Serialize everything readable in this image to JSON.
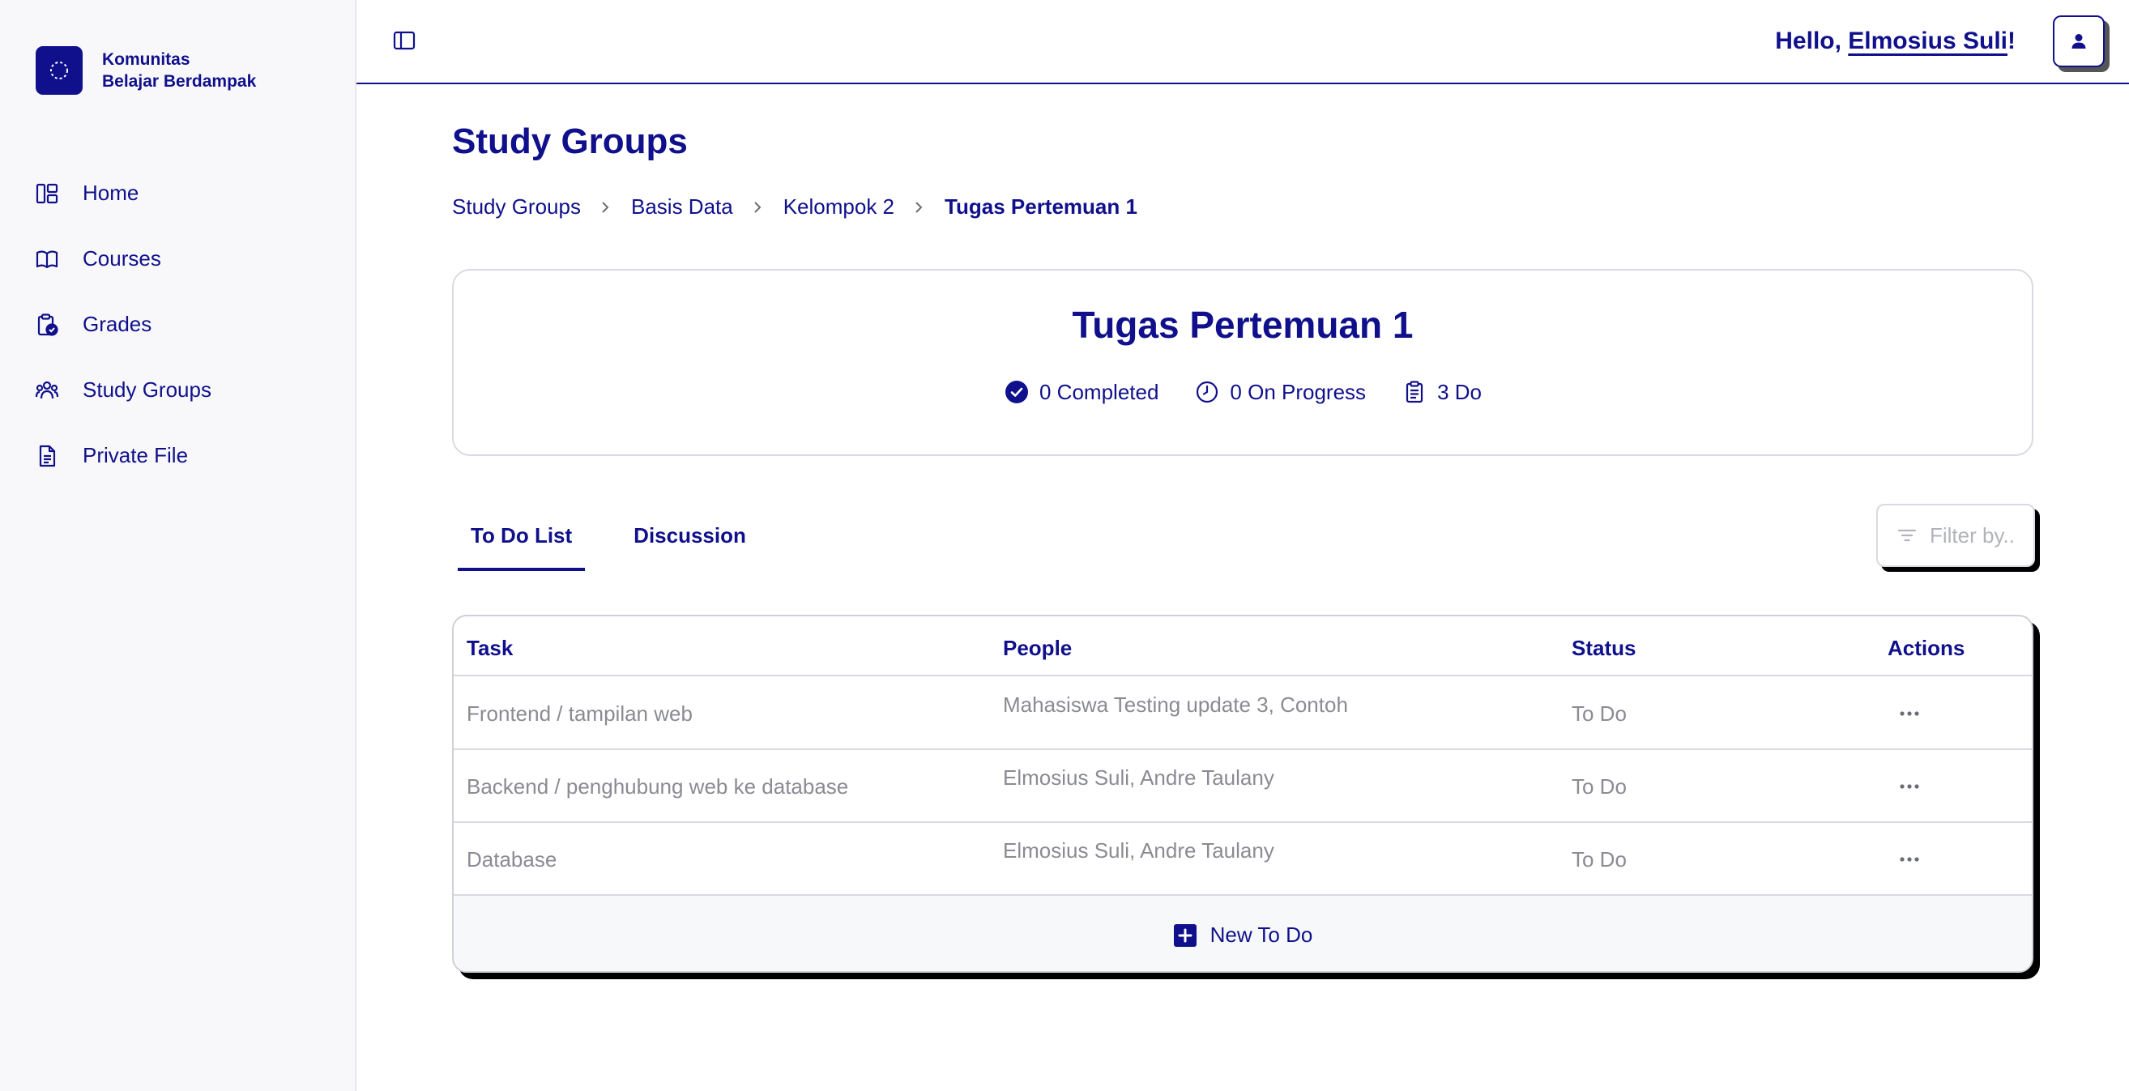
{
  "brand": {
    "line1": "Komunitas",
    "line2": "Belajar Berdampak"
  },
  "sidebar": {
    "items": [
      {
        "label": "Home",
        "icon": "dashboard-icon"
      },
      {
        "label": "Courses",
        "icon": "book-icon"
      },
      {
        "label": "Grades",
        "icon": "clipboard-check-icon"
      },
      {
        "label": "Study Groups",
        "icon": "users-icon"
      },
      {
        "label": "Private File",
        "icon": "file-icon"
      }
    ]
  },
  "header": {
    "greeting": "Hello, ",
    "user_name": "Elmosius Suli",
    "exclaim": "!"
  },
  "page": {
    "title": "Study Groups"
  },
  "breadcrumb": [
    "Study Groups",
    "Basis Data",
    "Kelompok 2",
    "Tugas Pertemuan 1"
  ],
  "summary": {
    "title": "Tugas Pertemuan 1",
    "completed": "0 Completed",
    "on_progress": "0 On Progress",
    "todo": "3 Do"
  },
  "tabs": [
    {
      "label": "To Do List",
      "active": true
    },
    {
      "label": "Discussion",
      "active": false
    }
  ],
  "filter": {
    "placeholder": "Filter by.."
  },
  "table": {
    "headers": {
      "task": "Task",
      "people": "People",
      "status": "Status",
      "actions": "Actions"
    },
    "rows": [
      {
        "task": "Frontend / tampilan web",
        "people": "Mahasiswa Testing update 3, Contoh",
        "status": "To Do"
      },
      {
        "task": "Backend / penghubung web ke database",
        "people": "Elmosius Suli, Andre Taulany",
        "status": "To Do"
      },
      {
        "task": "Database",
        "people": "Elmosius Suli, Andre Taulany",
        "status": "To Do"
      }
    ],
    "new_label": "New To Do"
  },
  "colors": {
    "primary": "#10108c",
    "muted_text": "#8a8b93",
    "border": "#d9dae2",
    "sidebar_bg": "#f8f8fa"
  }
}
